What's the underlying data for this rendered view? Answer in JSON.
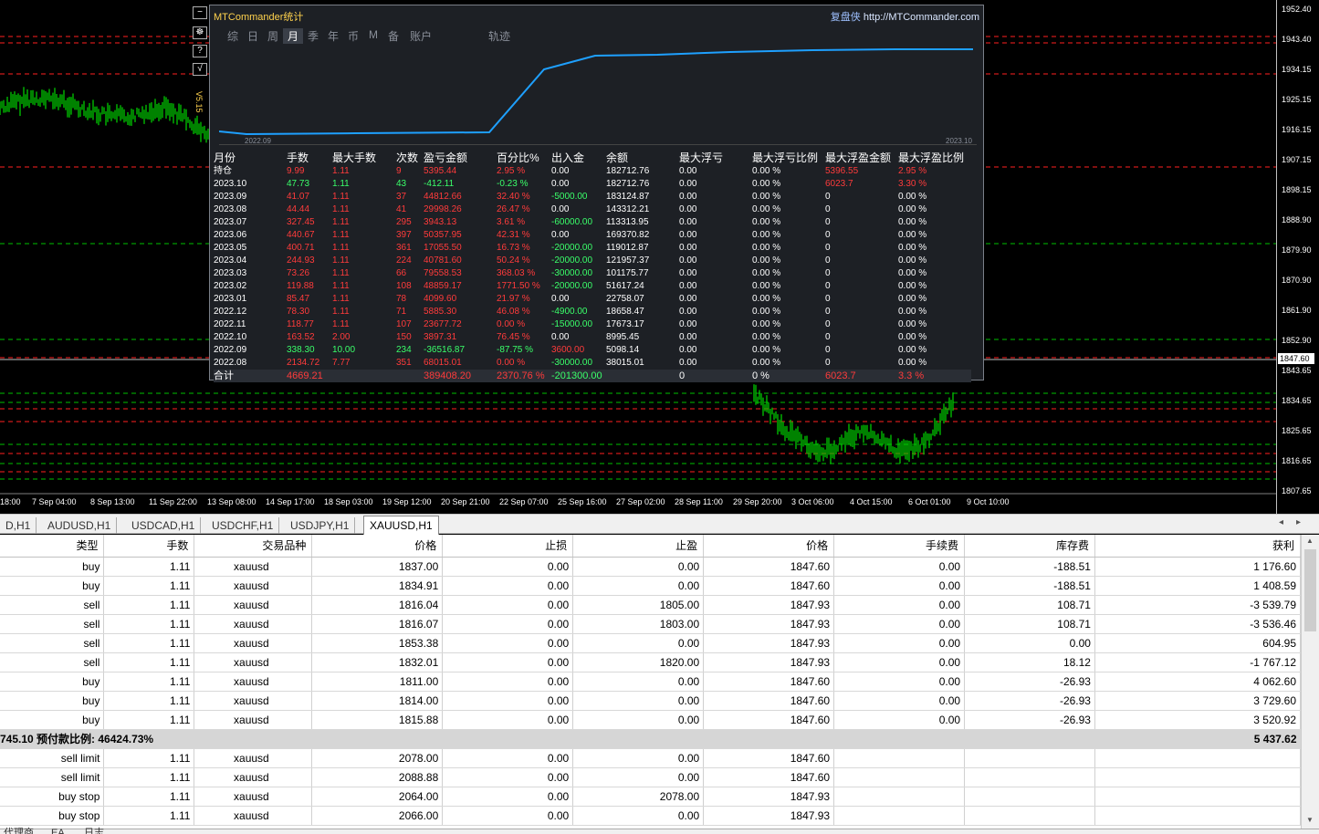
{
  "price_scale": [
    "1952.40",
    "1943.40",
    "1934.15",
    "1925.15",
    "1916.15",
    "1907.15",
    "1898.15",
    "1888.90",
    "1879.90",
    "1870.90",
    "1861.90",
    "1852.90",
    "1843.65",
    "1834.65",
    "1825.65",
    "1816.65",
    "1807.65"
  ],
  "current_price": "1847.60",
  "time_axis": [
    "18:00",
    "7 Sep 04:00",
    "8 Sep 13:00",
    "11 Sep 22:00",
    "13 Sep 08:00",
    "14 Sep 17:00",
    "18 Sep 03:00",
    "19 Sep 12:00",
    "20 Sep 21:00",
    "22 Sep 07:00",
    "25 Sep 16:00",
    "27 Sep 02:00",
    "28 Sep 11:00",
    "29 Sep 20:00",
    "3 Oct 06:00",
    "4 Oct 15:00",
    "6 Oct 01:00",
    "9 Oct 10:00"
  ],
  "side_buttons": [
    "−",
    "☸",
    "?",
    "√"
  ],
  "version_label": "V5.15",
  "stats": {
    "title": "MTCommander统计",
    "brand_cn": "复盘侠",
    "brand_url": "http://MTCommander.com",
    "tabs": [
      "综",
      "日",
      "周",
      "月",
      "季",
      "年",
      "币",
      "M",
      "备",
      "账户",
      "轨迹"
    ],
    "active_tab": "月",
    "graph_x_start": "2022.09",
    "graph_x_end": "2023.10",
    "headers": [
      "月份",
      "手数",
      "最大手数",
      "次数",
      "盈亏金额",
      "百分比%",
      "出入金",
      "余额",
      "最大浮亏",
      "最大浮亏比例",
      "最大浮盈金额",
      "最大浮盈比例"
    ],
    "rows": [
      [
        "持仓",
        "9.99",
        "1.11",
        "9",
        "5395.44",
        "2.95 %",
        "0.00",
        "182712.76",
        "0.00",
        "0.00 %",
        "5396.55",
        "2.95 %"
      ],
      [
        "2023.10",
        "47.73",
        "1.11",
        "43",
        "-412.11",
        "-0.23 %",
        "0.00",
        "182712.76",
        "0.00",
        "0.00 %",
        "6023.7",
        "3.30 %"
      ],
      [
        "2023.09",
        "41.07",
        "1.11",
        "37",
        "44812.66",
        "32.40 %",
        "-5000.00",
        "183124.87",
        "0.00",
        "0.00 %",
        "0",
        "0.00 %"
      ],
      [
        "2023.08",
        "44.44",
        "1.11",
        "41",
        "29998.26",
        "26.47 %",
        "0.00",
        "143312.21",
        "0.00",
        "0.00 %",
        "0",
        "0.00 %"
      ],
      [
        "2023.07",
        "327.45",
        "1.11",
        "295",
        "3943.13",
        "3.61 %",
        "-60000.00",
        "113313.95",
        "0.00",
        "0.00 %",
        "0",
        "0.00 %"
      ],
      [
        "2023.06",
        "440.67",
        "1.11",
        "397",
        "50357.95",
        "42.31 %",
        "0.00",
        "169370.82",
        "0.00",
        "0.00 %",
        "0",
        "0.00 %"
      ],
      [
        "2023.05",
        "400.71",
        "1.11",
        "361",
        "17055.50",
        "16.73 %",
        "-20000.00",
        "119012.87",
        "0.00",
        "0.00 %",
        "0",
        "0.00 %"
      ],
      [
        "2023.04",
        "244.93",
        "1.11",
        "224",
        "40781.60",
        "50.24 %",
        "-20000.00",
        "121957.37",
        "0.00",
        "0.00 %",
        "0",
        "0.00 %"
      ],
      [
        "2023.03",
        "73.26",
        "1.11",
        "66",
        "79558.53",
        "368.03 %",
        "-30000.00",
        "101175.77",
        "0.00",
        "0.00 %",
        "0",
        "0.00 %"
      ],
      [
        "2023.02",
        "119.88",
        "1.11",
        "108",
        "48859.17",
        "1771.50 %",
        "-20000.00",
        "51617.24",
        "0.00",
        "0.00 %",
        "0",
        "0.00 %"
      ],
      [
        "2023.01",
        "85.47",
        "1.11",
        "78",
        "4099.60",
        "21.97 %",
        "0.00",
        "22758.07",
        "0.00",
        "0.00 %",
        "0",
        "0.00 %"
      ],
      [
        "2022.12",
        "78.30",
        "1.11",
        "71",
        "5885.30",
        "46.08 %",
        "-4900.00",
        "18658.47",
        "0.00",
        "0.00 %",
        "0",
        "0.00 %"
      ],
      [
        "2022.11",
        "118.77",
        "1.11",
        "107",
        "23677.72",
        "0.00 %",
        "-15000.00",
        "17673.17",
        "0.00",
        "0.00 %",
        "0",
        "0.00 %"
      ],
      [
        "2022.10",
        "163.52",
        "2.00",
        "150",
        "3897.31",
        "76.45 %",
        "0.00",
        "8995.45",
        "0.00",
        "0.00 %",
        "0",
        "0.00 %"
      ],
      [
        "2022.09",
        "338.30",
        "10.00",
        "234",
        "-36516.87",
        "-87.75 %",
        "3600.00",
        "5098.14",
        "0.00",
        "0.00 %",
        "0",
        "0.00 %"
      ],
      [
        "2022.08",
        "2134.72",
        "7.77",
        "351",
        "68015.01",
        "0.00 %",
        "-30000.00",
        "38015.01",
        "0.00",
        "0.00 %",
        "0",
        "0.00 %"
      ]
    ],
    "total": [
      "合计",
      "4669.21",
      "",
      "",
      "389408.20",
      "2370.76 %",
      "-201300.00",
      "",
      "0",
      "0 %",
      "6023.7",
      "3.3 %"
    ]
  },
  "chart_tabs": [
    "D,H1",
    "AUDUSD,H1",
    "USDCAD,H1",
    "USDCHF,H1",
    "USDJPY,H1",
    "XAUUSD,H1"
  ],
  "active_chart_tab": "XAUUSD,H1",
  "orders": {
    "headers": [
      "类型",
      "手数",
      "交易品种",
      "价格",
      "止损",
      "止盈",
      "价格",
      "手续费",
      "库存费",
      "获利"
    ],
    "rows": [
      [
        "buy",
        "1.11",
        "xauusd",
        "1837.00",
        "0.00",
        "0.00",
        "1847.60",
        "0.00",
        "-188.51",
        "1 176.60"
      ],
      [
        "buy",
        "1.11",
        "xauusd",
        "1834.91",
        "0.00",
        "0.00",
        "1847.60",
        "0.00",
        "-188.51",
        "1 408.59"
      ],
      [
        "sell",
        "1.11",
        "xauusd",
        "1816.04",
        "0.00",
        "1805.00",
        "1847.93",
        "0.00",
        "108.71",
        "-3 539.79"
      ],
      [
        "sell",
        "1.11",
        "xauusd",
        "1816.07",
        "0.00",
        "1803.00",
        "1847.93",
        "0.00",
        "108.71",
        "-3 536.46"
      ],
      [
        "sell",
        "1.11",
        "xauusd",
        "1853.38",
        "0.00",
        "0.00",
        "1847.93",
        "0.00",
        "0.00",
        "604.95"
      ],
      [
        "sell",
        "1.11",
        "xauusd",
        "1832.01",
        "0.00",
        "1820.00",
        "1847.93",
        "0.00",
        "18.12",
        "-1 767.12"
      ],
      [
        "buy",
        "1.11",
        "xauusd",
        "1811.00",
        "0.00",
        "0.00",
        "1847.60",
        "0.00",
        "-26.93",
        "4 062.60"
      ],
      [
        "buy",
        "1.11",
        "xauusd",
        "1814.00",
        "0.00",
        "0.00",
        "1847.60",
        "0.00",
        "-26.93",
        "3 729.60"
      ],
      [
        "buy",
        "1.11",
        "xauusd",
        "1815.88",
        "0.00",
        "0.00",
        "1847.60",
        "0.00",
        "-26.93",
        "3 520.92"
      ]
    ],
    "summary_left": "745.10  预付款比例: 46424.73%",
    "summary_right": "5 437.62",
    "pending": [
      [
        "sell limit",
        "1.11",
        "xauusd",
        "2078.00",
        "0.00",
        "0.00",
        "1847.60"
      ],
      [
        "sell limit",
        "1.11",
        "xauusd",
        "2088.88",
        "0.00",
        "0.00",
        "1847.60"
      ],
      [
        "buy stop",
        "1.11",
        "xauusd",
        "2064.00",
        "0.00",
        "2078.00",
        "1847.93"
      ],
      [
        "buy stop",
        "1.11",
        "xauusd",
        "2066.00",
        "0.00",
        "0.00",
        "1847.93"
      ]
    ]
  },
  "bottom_tabs": [
    "代理商",
    "EA",
    "日志"
  ],
  "colors": {
    "bull": "#00c800",
    "level_red": "#ff2020",
    "level_green": "#00c000",
    "curve": "#1ea0ff"
  }
}
